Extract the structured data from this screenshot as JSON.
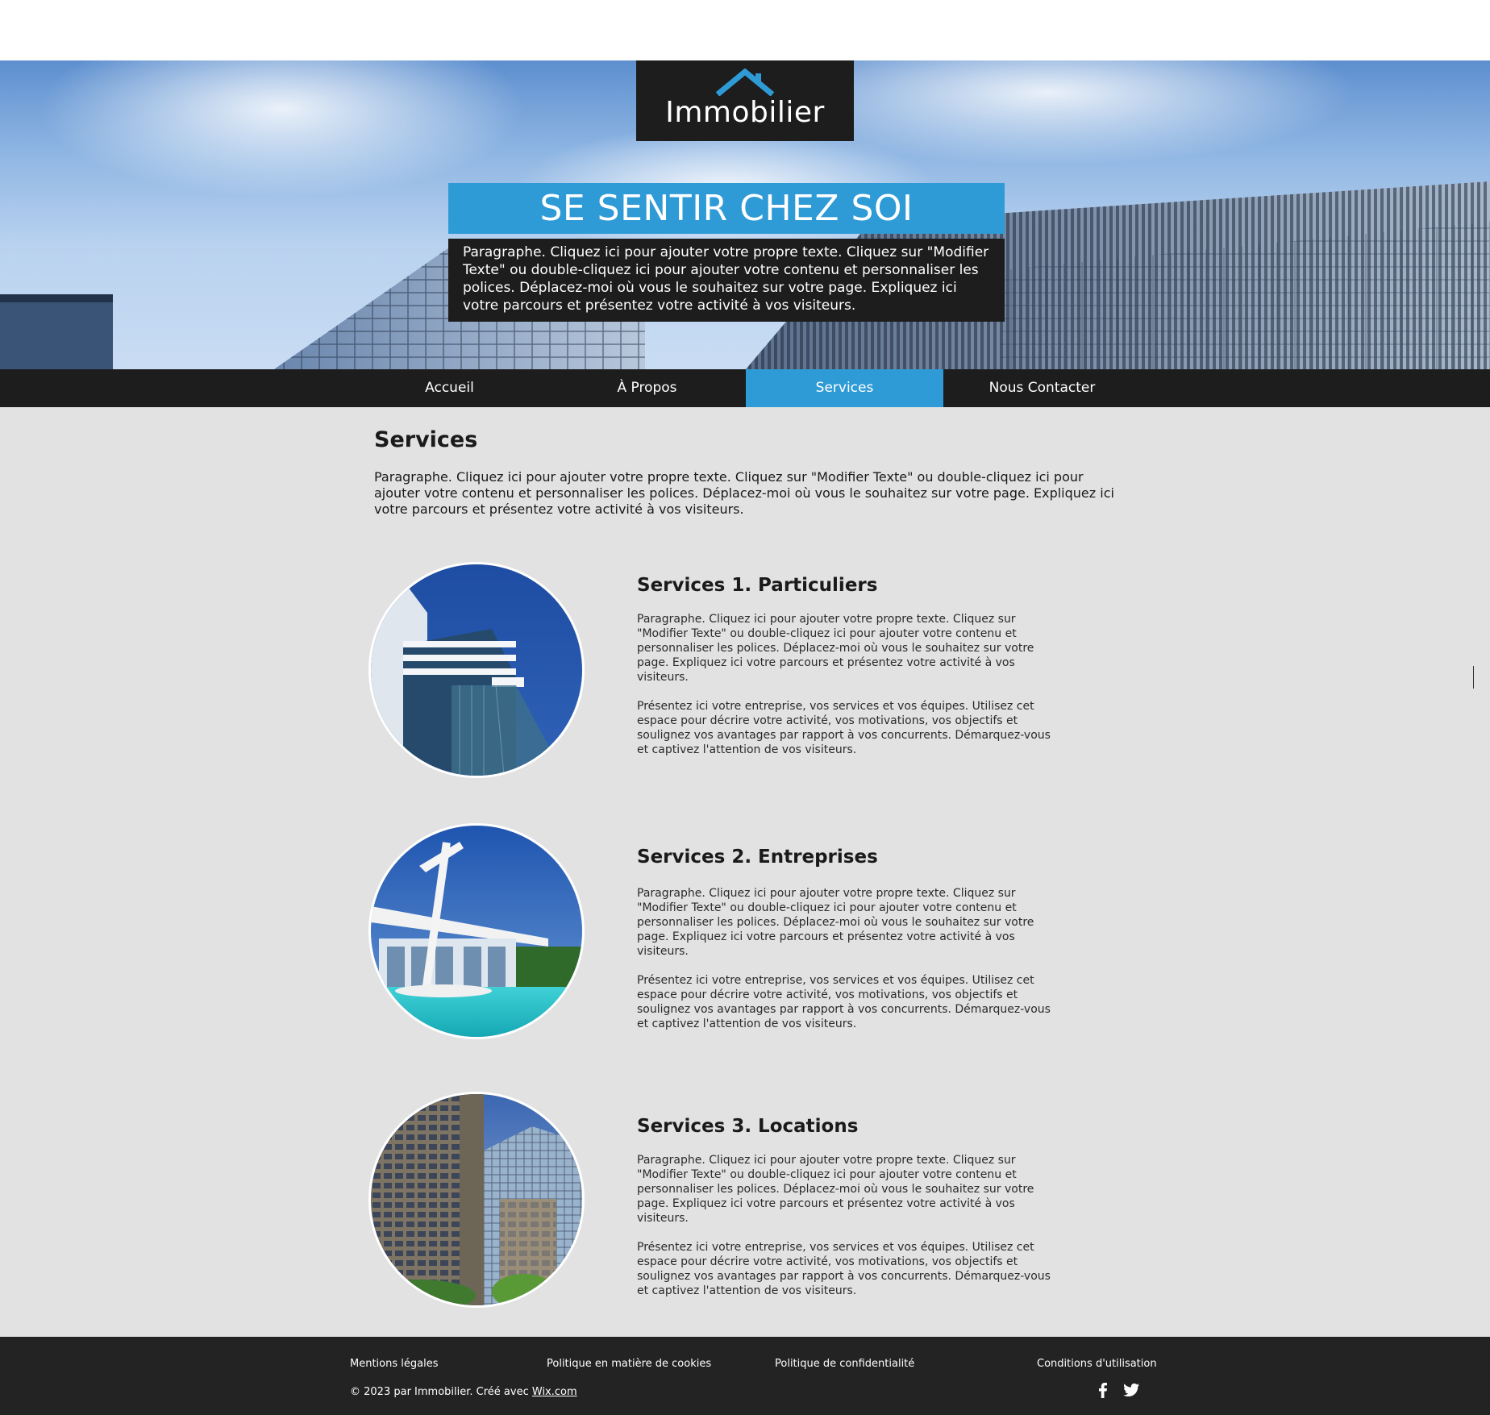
{
  "brand": {
    "name": "Immobilier"
  },
  "hero": {
    "tagline": "SE SENTIR CHEZ SOI",
    "paragraph": "Paragraphe. Cliquez ici pour ajouter votre propre texte. Cliquez sur \"Modifier Texte\" ou double-cliquez ici pour ajouter votre contenu et personnaliser les polices. Déplacez-moi où vous le souhaitez sur votre page. Expliquez ici votre parcours et présentez votre activité à vos visiteurs."
  },
  "nav": {
    "items": [
      {
        "label": "Accueil"
      },
      {
        "label": "À Propos"
      },
      {
        "label": "Services"
      },
      {
        "label": "Nous Contacter"
      }
    ],
    "active": "Services",
    "active_color": "#2f9bd6"
  },
  "main": {
    "title": "Services",
    "paragraph": "Paragraphe. Cliquez ici pour ajouter votre propre texte. Cliquez sur \"Modifier Texte\" ou double-cliquez ici pour ajouter votre contenu et personnaliser les polices. Déplacez-moi où vous le souhaitez sur votre page. Expliquez ici votre parcours et présentez votre activité à vos visiteurs."
  },
  "services": [
    {
      "title": "Services 1. Particuliers",
      "p1": "Paragraphe. Cliquez ici pour ajouter votre propre texte. Cliquez sur \"Modifier Texte\" ou double-cliquez ici pour ajouter votre contenu et personnaliser les polices. Déplacez-moi où vous le souhaitez sur votre page. Expliquez ici votre parcours et présentez votre activité à vos visiteurs.",
      "p2": "Présentez ici votre entreprise, vos services et vos équipes. Utilisez cet espace pour décrire votre activité, vos motivations, vos objectifs et soulignez vos avantages par rapport à vos concurrents. Démarquez-vous et captivez l'attention de vos visiteurs."
    },
    {
      "title": "Services 2. Entreprises",
      "p1": "Paragraphe. Cliquez ici pour ajouter votre propre texte. Cliquez sur \"Modifier Texte\" ou double-cliquez ici pour ajouter votre contenu et personnaliser les polices. Déplacez-moi où vous le souhaitez sur votre page. Expliquez ici votre parcours et présentez votre activité à vos visiteurs.",
      "p2": "Présentez ici votre entreprise, vos services et vos équipes. Utilisez cet espace pour décrire votre activité, vos motivations, vos objectifs et soulignez vos avantages par rapport à vos concurrents. Démarquez-vous et captivez l'attention de vos visiteurs."
    },
    {
      "title": "Services 3. Locations",
      "p1": "Paragraphe. Cliquez ici pour ajouter votre propre texte. Cliquez sur \"Modifier Texte\" ou double-cliquez ici pour ajouter votre contenu et personnaliser les polices. Déplacez-moi où vous le souhaitez sur votre page. Expliquez ici votre parcours et présentez votre activité à vos visiteurs.",
      "p2": "Présentez ici votre entreprise, vos services et vos équipes. Utilisez cet espace pour décrire votre activité, vos motivations, vos objectifs et soulignez vos avantages par rapport à vos concurrents. Démarquez-vous et captivez l'attention de vos visiteurs."
    }
  ],
  "footer": {
    "links": [
      {
        "label": "Mentions légales"
      },
      {
        "label": "Politique en matière de cookies"
      },
      {
        "label": "Politique de confidentialité"
      },
      {
        "label": "Conditions d'utilisation"
      }
    ],
    "copyright_prefix": "© 2023 par Immobilier. Créé avec ",
    "copyright_link": "Wix.com",
    "social": [
      {
        "icon": "facebook-icon"
      },
      {
        "icon": "twitter-icon"
      }
    ]
  },
  "colors": {
    "accent": "#2f9bd6",
    "dark": "#1d1d1d",
    "background": "#e2e2e2",
    "footer": "#232323"
  }
}
